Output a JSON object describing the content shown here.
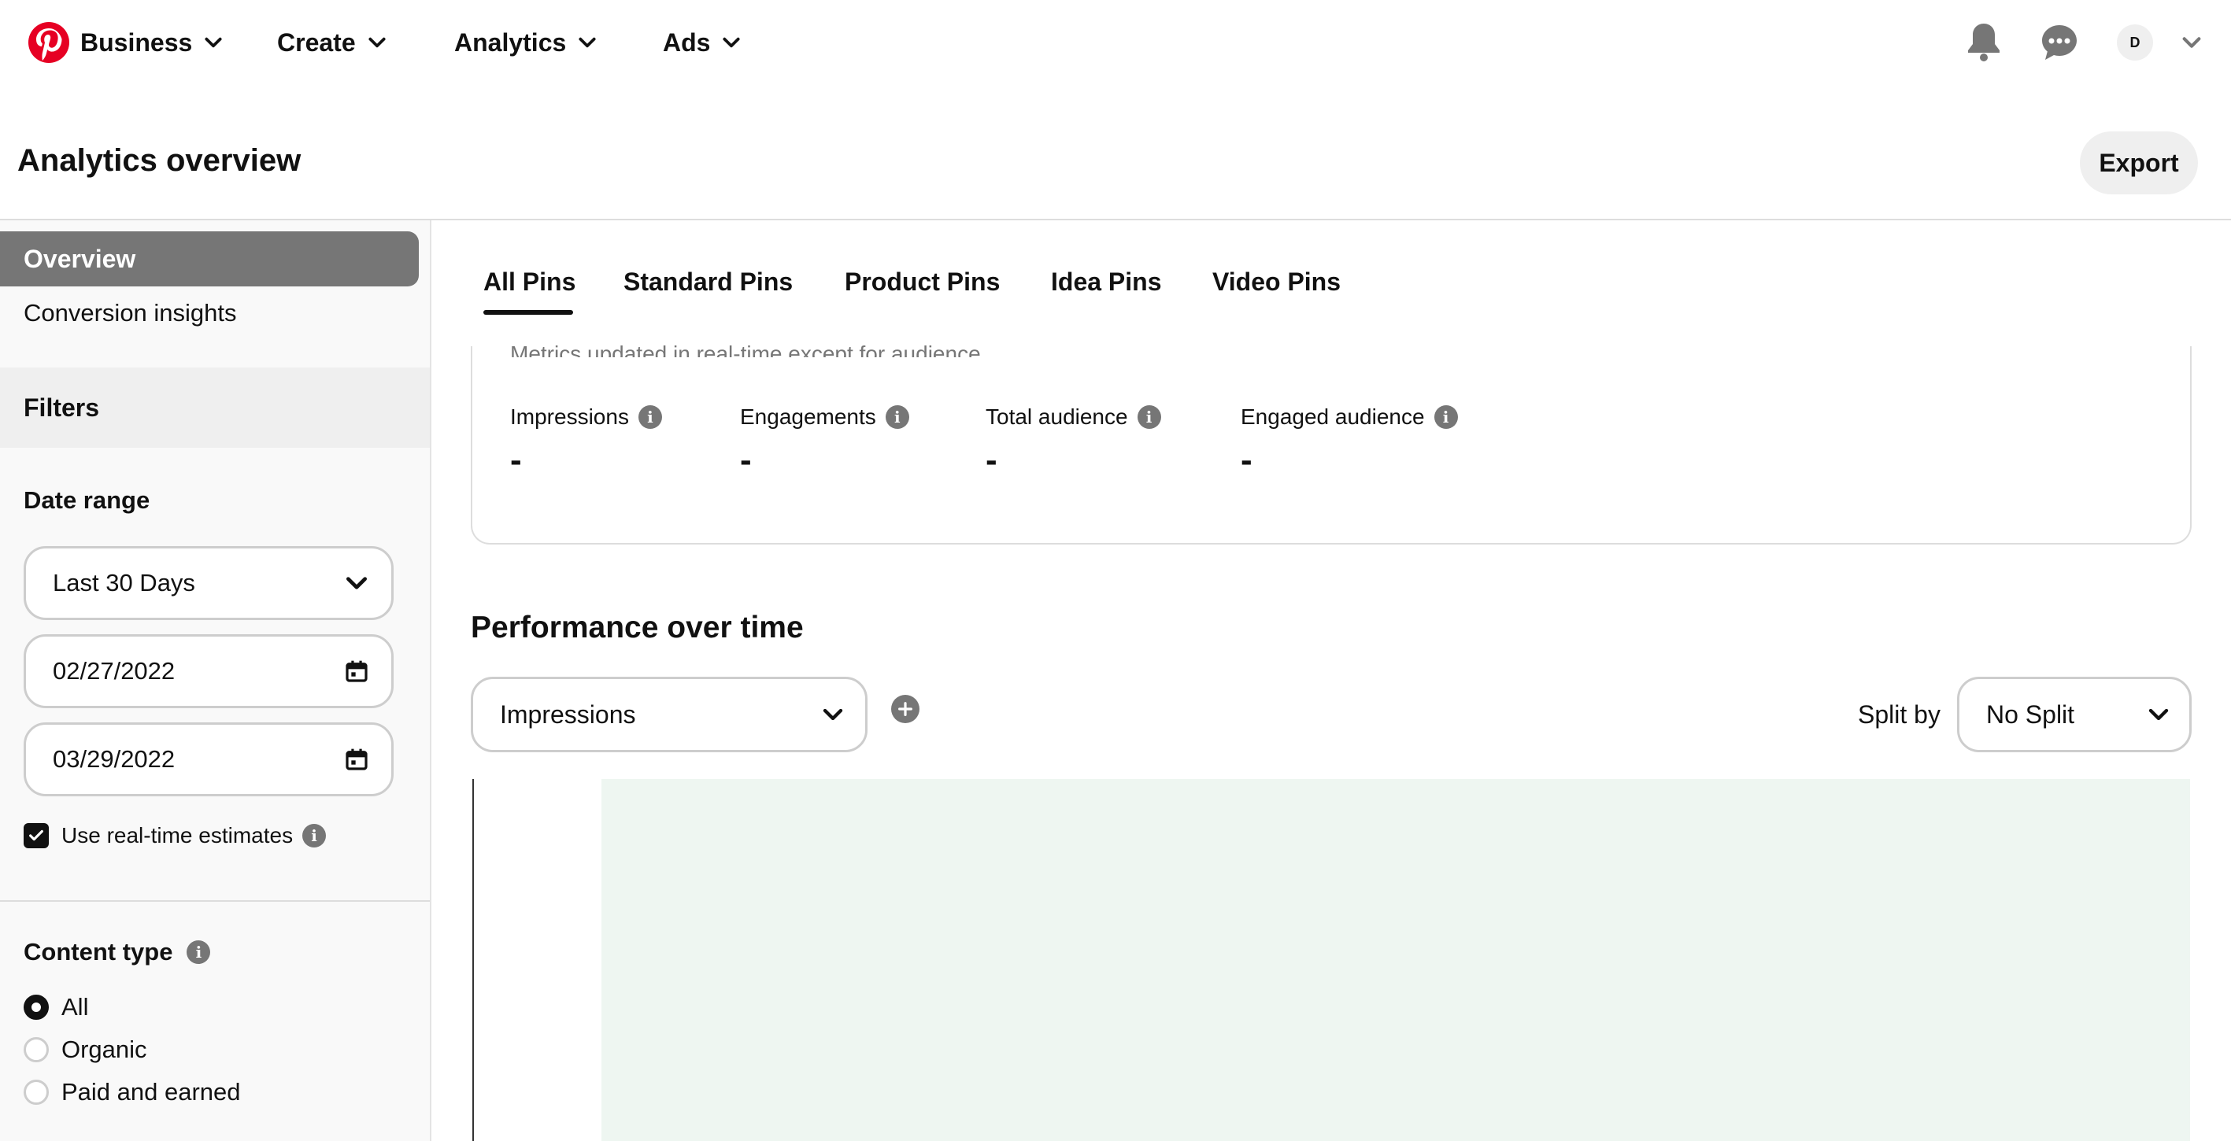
{
  "nav": {
    "items": [
      {
        "label": "Business"
      },
      {
        "label": "Create"
      },
      {
        "label": "Analytics"
      },
      {
        "label": "Ads"
      }
    ],
    "avatar_initial": "D"
  },
  "header": {
    "title": "Analytics overview",
    "export_label": "Export"
  },
  "sidebar": {
    "overview_label": "Overview",
    "conversion_label": "Conversion insights",
    "filters_label": "Filters",
    "date_range": {
      "label": "Date range",
      "preset": "Last 30 Days",
      "start_date": "02/27/2022",
      "end_date": "03/29/2022",
      "realtime_label": "Use real-time estimates",
      "realtime_checked": true
    },
    "content_type": {
      "label": "Content type",
      "options": [
        {
          "label": "All",
          "checked": true
        },
        {
          "label": "Organic",
          "checked": false
        },
        {
          "label": "Paid and earned",
          "checked": false
        }
      ]
    }
  },
  "tabs": [
    {
      "label": "All Pins",
      "active": true
    },
    {
      "label": "Standard Pins",
      "active": false
    },
    {
      "label": "Product Pins",
      "active": false
    },
    {
      "label": "Idea Pins",
      "active": false
    },
    {
      "label": "Video Pins",
      "active": false
    }
  ],
  "metrics": {
    "note": "Metrics updated in real-time except for audience.",
    "items": [
      {
        "label": "Impressions",
        "value": "-"
      },
      {
        "label": "Engagements",
        "value": "-"
      },
      {
        "label": "Total audience",
        "value": "-"
      },
      {
        "label": "Engaged audience",
        "value": "-"
      }
    ]
  },
  "performance": {
    "title": "Performance over time",
    "metric_selected": "Impressions",
    "split_label": "Split by",
    "split_selected": "No Split"
  },
  "colors": {
    "brand": "#e60023",
    "active_nav": "#767676",
    "chart_fill": "#eef6f1"
  }
}
